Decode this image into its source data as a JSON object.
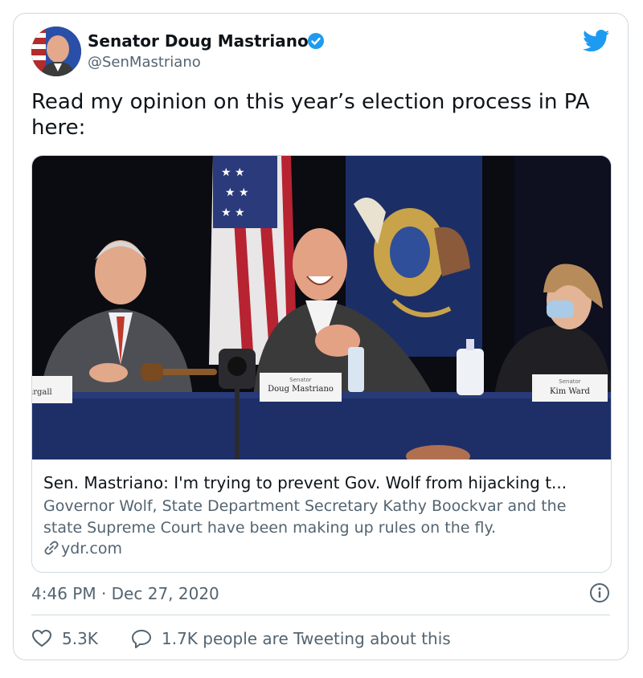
{
  "tweet": {
    "author_name": "Senator Doug Mastriano",
    "author_handle": "@SenMastriano",
    "text": "Read my opinion on this year’s election process in PA here:",
    "timestamp": "4:46 PM · Dec 27, 2020",
    "likes": "5.3K",
    "talking": "1.7K people are Tweeting about this"
  },
  "link_card": {
    "title": "Sen. Mastriano: I'm trying to prevent Gov. Wolf from hijacking t...",
    "description": "Governor Wolf, State Department Secretary Kathy Boockvar and the state Supreme Court have been making up rules on the fly.",
    "domain": "ydr.com"
  },
  "photo": {
    "placard_left": "irgall",
    "placard_center_small": "Senator",
    "placard_center": "Doug Mastriano",
    "placard_right_small": "Senator",
    "placard_right": "Kim Ward"
  },
  "colors": {
    "accent": "#1d9bf0",
    "secondary_text": "#536471",
    "border": "#cfd9de"
  },
  "icons": [
    "verified-badge-icon",
    "twitter-bird-icon",
    "link-icon",
    "info-icon",
    "heart-icon",
    "reply-bubble-icon"
  ]
}
